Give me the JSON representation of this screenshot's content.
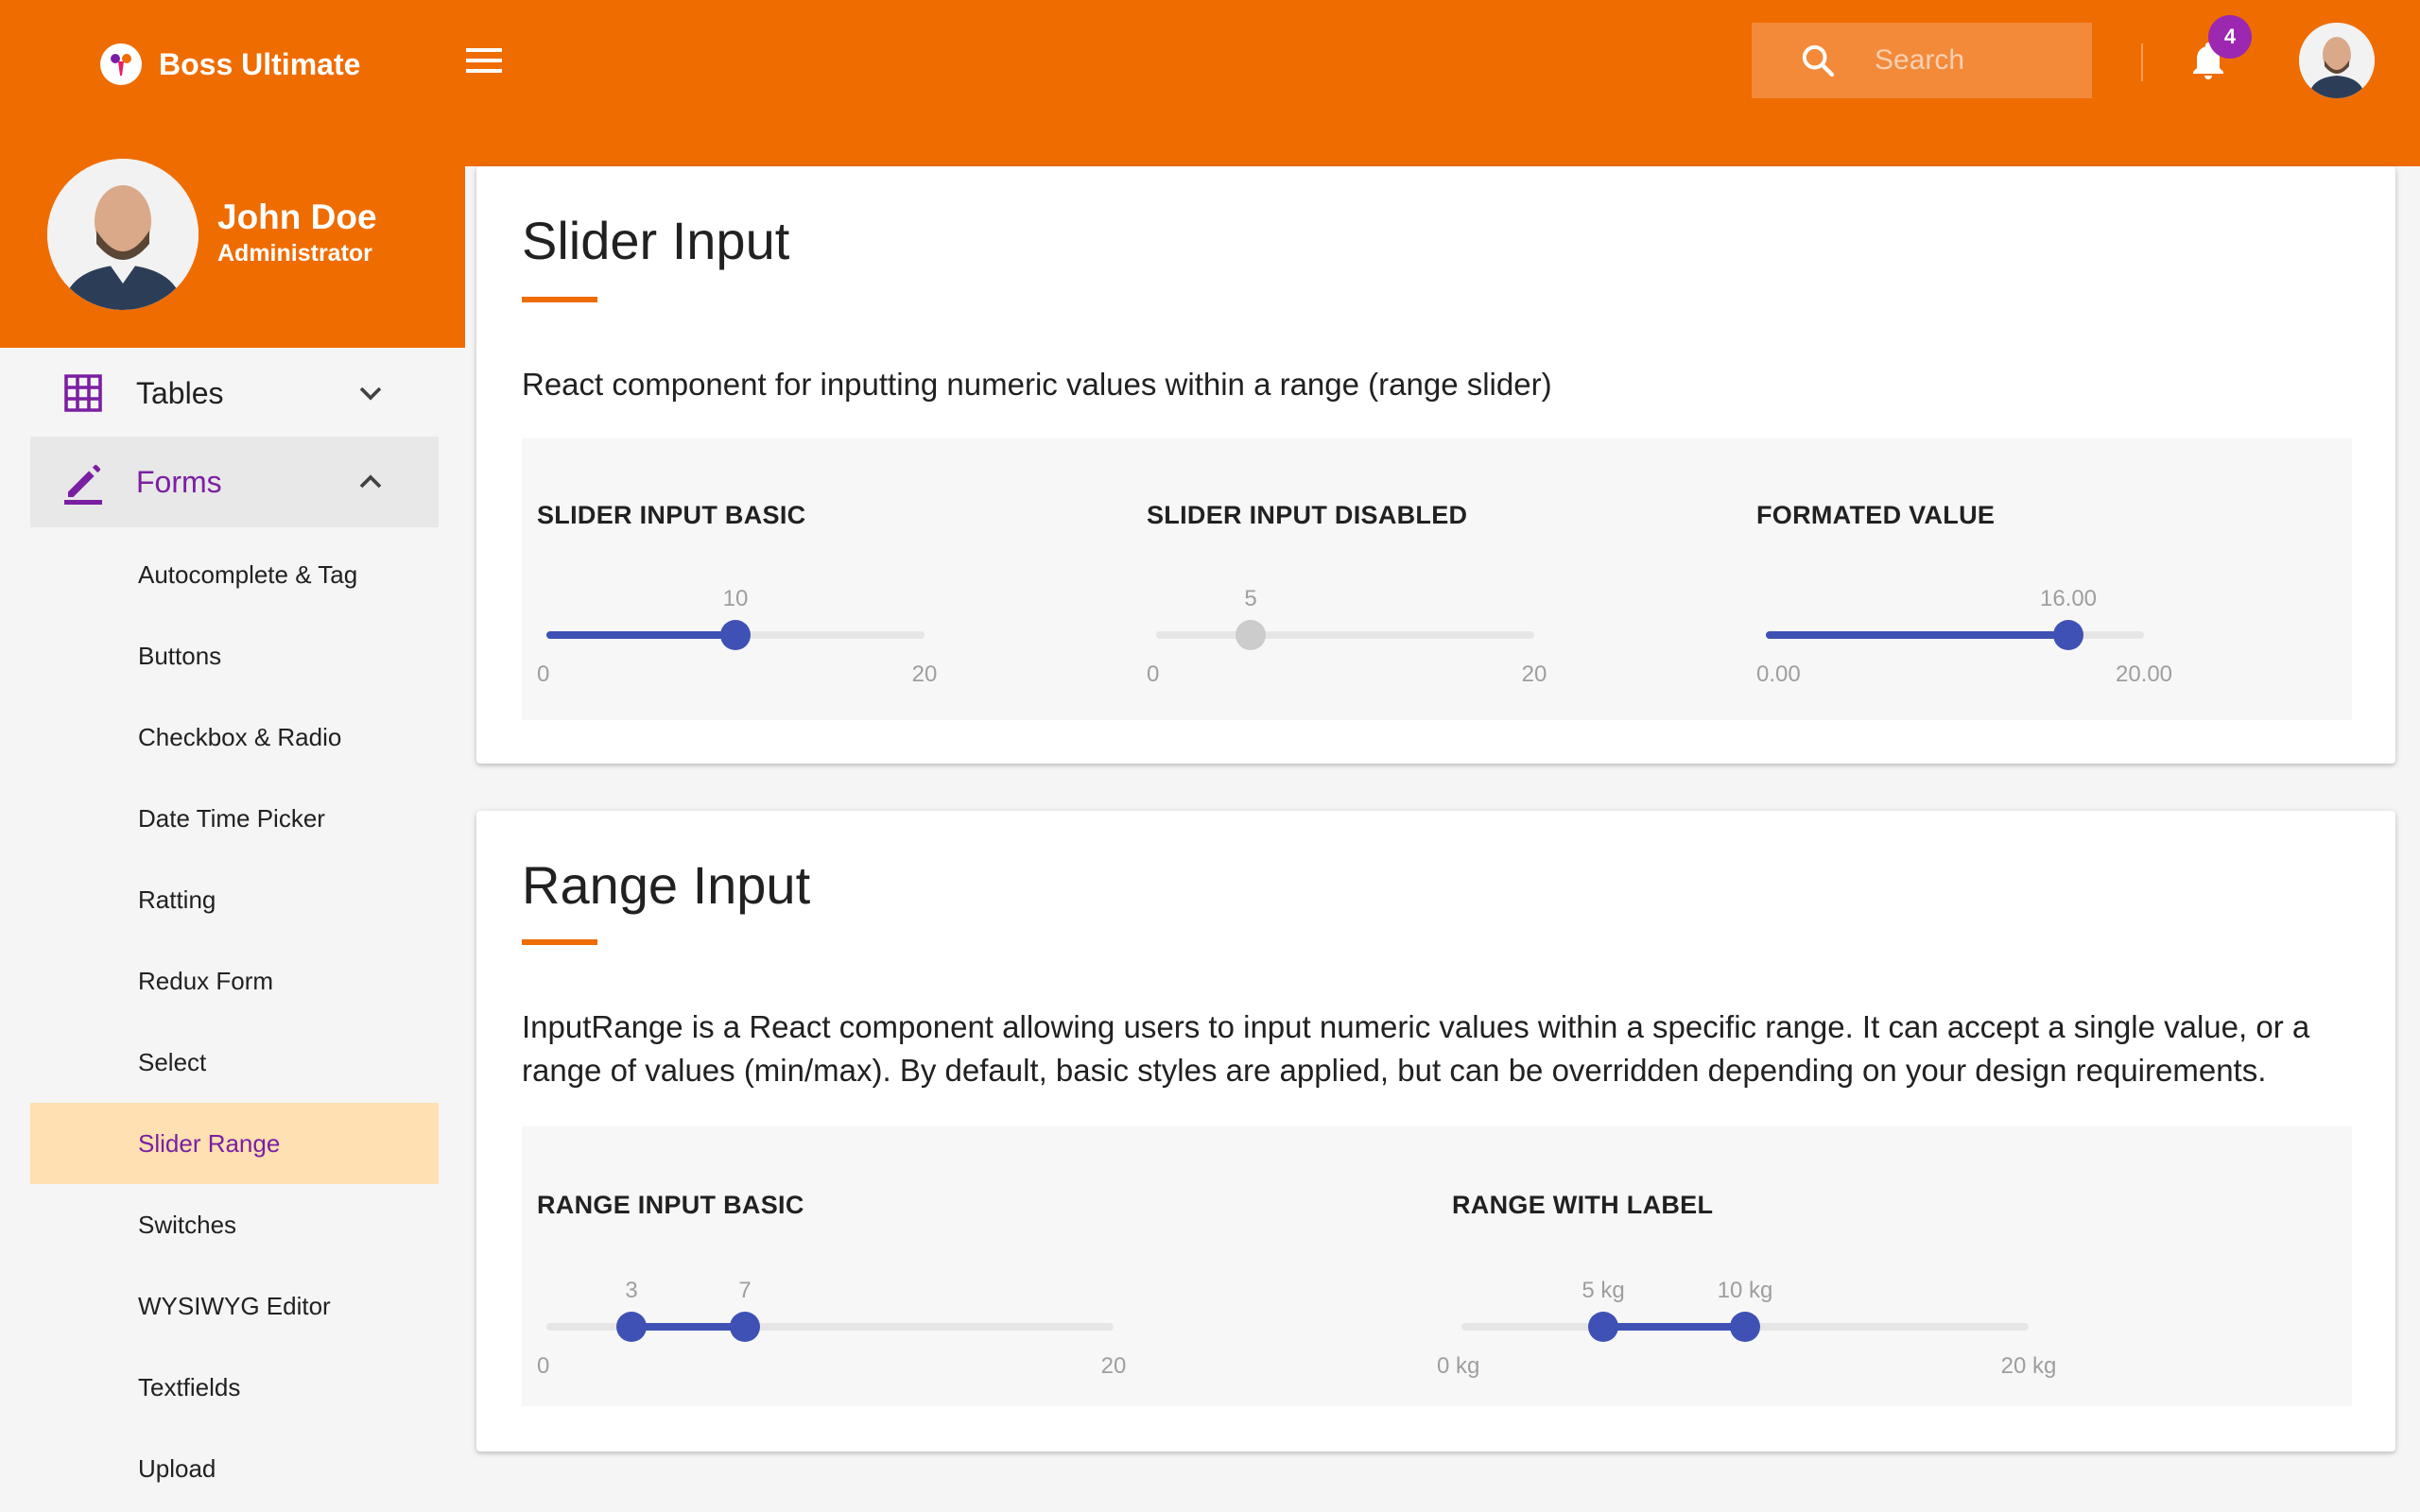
{
  "app": {
    "brand_name": "Boss Ultimate",
    "search_placeholder": "Search",
    "notification_count": "4",
    "accent_color": "#ef6c00",
    "primary_color": "#3f51b5"
  },
  "profile": {
    "name": "John Doe",
    "role": "Administrator"
  },
  "sidebar": {
    "groups": [
      {
        "label": "Tables",
        "icon": "table-grid-icon",
        "expanded": false
      },
      {
        "label": "Forms",
        "icon": "pencil-icon",
        "expanded": true
      }
    ],
    "items": [
      {
        "label": "Autocomplete & Tag",
        "active": false
      },
      {
        "label": "Buttons",
        "active": false
      },
      {
        "label": "Checkbox & Radio",
        "active": false
      },
      {
        "label": "Date Time Picker",
        "active": false
      },
      {
        "label": "Ratting",
        "active": false
      },
      {
        "label": "Redux Form",
        "active": false
      },
      {
        "label": "Select",
        "active": false
      },
      {
        "label": "Slider Range",
        "active": true
      },
      {
        "label": "Switches",
        "active": false
      },
      {
        "label": "WYSIWYG Editor",
        "active": false
      },
      {
        "label": "Textfields",
        "active": false
      },
      {
        "label": "Upload",
        "active": false
      }
    ]
  },
  "slider_card": {
    "title": "Slider Input",
    "description": "React component for inputting numeric values within a range (range slider)",
    "demos": [
      {
        "title": "SLIDER INPUT BASIC",
        "value": 10,
        "value_label": "10",
        "min": 0,
        "max": 20,
        "min_label": "0",
        "max_label": "20",
        "disabled": false
      },
      {
        "title": "SLIDER INPUT DISABLED",
        "value": 5,
        "value_label": "5",
        "min": 0,
        "max": 20,
        "min_label": "0",
        "max_label": "20",
        "disabled": true
      },
      {
        "title": "FORMATED VALUE",
        "value": 16,
        "value_label": "16.00",
        "min": 0,
        "max": 20,
        "min_label": "0.00",
        "max_label": "20.00",
        "disabled": false
      }
    ]
  },
  "range_card": {
    "title": "Range Input",
    "description": "InputRange is a React component allowing users to input numeric values within a specific range. It can accept a single value, or a range of values (min/max). By default, basic styles are applied, but can be overridden depending on your design requirements.",
    "demos": [
      {
        "title": "RANGE INPUT BASIC",
        "low": 3,
        "high": 7,
        "low_label": "3",
        "high_label": "7",
        "min": 0,
        "max": 20,
        "min_label": "0",
        "max_label": "20"
      },
      {
        "title": "RANGE WITH LABEL",
        "low": 5,
        "high": 10,
        "low_label": "5 kg",
        "high_label": "10 kg",
        "min": 0,
        "max": 20,
        "min_label": "0 kg",
        "max_label": "20 kg"
      }
    ]
  }
}
